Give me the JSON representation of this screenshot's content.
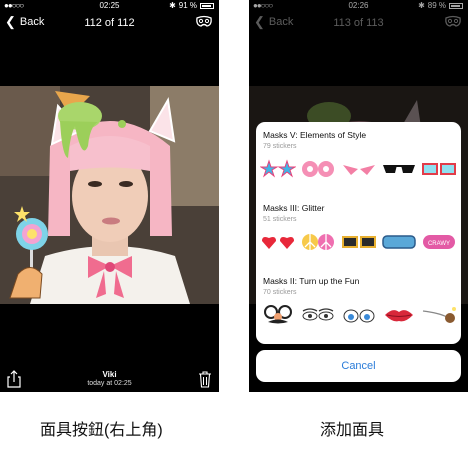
{
  "left_screen": {
    "status": {
      "signal": "●●○○○",
      "time": "02:25",
      "battery": "91 %"
    },
    "nav": {
      "back_label": "Back",
      "title": "112 of 112"
    },
    "footer": {
      "author": "Viki",
      "date": "today at 02:25"
    },
    "caption": "面具按鈕(右上角)"
  },
  "right_screen": {
    "status": {
      "signal": "●●○○○",
      "time": "02:26",
      "battery": "89 %"
    },
    "nav": {
      "back_label": "Back",
      "title": "113 of 113"
    },
    "sheet": {
      "sections": [
        {
          "title": "Masks V: Elements of Style",
          "count": "79 stickers"
        },
        {
          "title": "Masks III: Glitter",
          "count": "51 stickers"
        },
        {
          "title": "Masks II: Turn up the Fun",
          "count": "70 stickers"
        }
      ]
    },
    "cancel_label": "Cancel",
    "caption": "添加面具"
  },
  "colors": {
    "accent": "#2a7cd9",
    "background": "#000000"
  },
  "icons": [
    "chevron-left-icon",
    "mask-icon",
    "share-icon",
    "trash-icon",
    "battery-icon",
    "bluetooth-icon"
  ]
}
